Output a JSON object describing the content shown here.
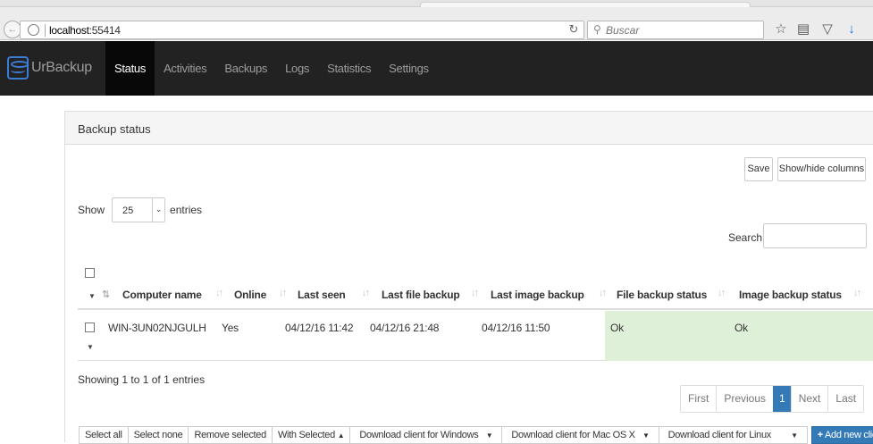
{
  "browser": {
    "url_host": "localhost",
    "url_rest": ":55414",
    "search_placeholder": "Buscar"
  },
  "navbar": {
    "brand": "UrBackup",
    "links": [
      "Status",
      "Activities",
      "Backups",
      "Logs",
      "Statistics",
      "Settings"
    ],
    "active": "Status"
  },
  "panel": {
    "title": "Backup status",
    "save_label": "Save",
    "showhide_label": "Show/hide columns",
    "show_label": "Show",
    "entries_value": "25",
    "entries_label": "entries",
    "search_label": "Search:",
    "columns": [
      "Computer name",
      "Online",
      "Last seen",
      "Last file backup",
      "Last image backup",
      "File backup status",
      "Image backup status"
    ],
    "rows": [
      {
        "computer_name": "WIN-3UN02NJGULH",
        "online": "Yes",
        "last_seen": "04/12/16 11:42",
        "last_file_backup": "04/12/16 21:48",
        "last_image_backup": "04/12/16 11:50",
        "file_backup_status": "Ok",
        "image_backup_status": "Ok"
      }
    ],
    "info": "Showing 1 to 1 of 1 entries",
    "pagination": [
      "First",
      "Previous",
      "1",
      "Next",
      "Last"
    ],
    "actions": {
      "select_all": "Select all",
      "select_none": "Select none",
      "remove_selected": "Remove selected",
      "with_selected": "With Selected",
      "dl_windows": "Download client for Windows",
      "dl_mac": "Download client for Mac OS X",
      "dl_linux": "Download client for Linux",
      "add_client": "Add new client"
    }
  },
  "colors": {
    "navbar": "#222222",
    "ok_cell": "#dff0d8",
    "primary": "#337ab7"
  }
}
